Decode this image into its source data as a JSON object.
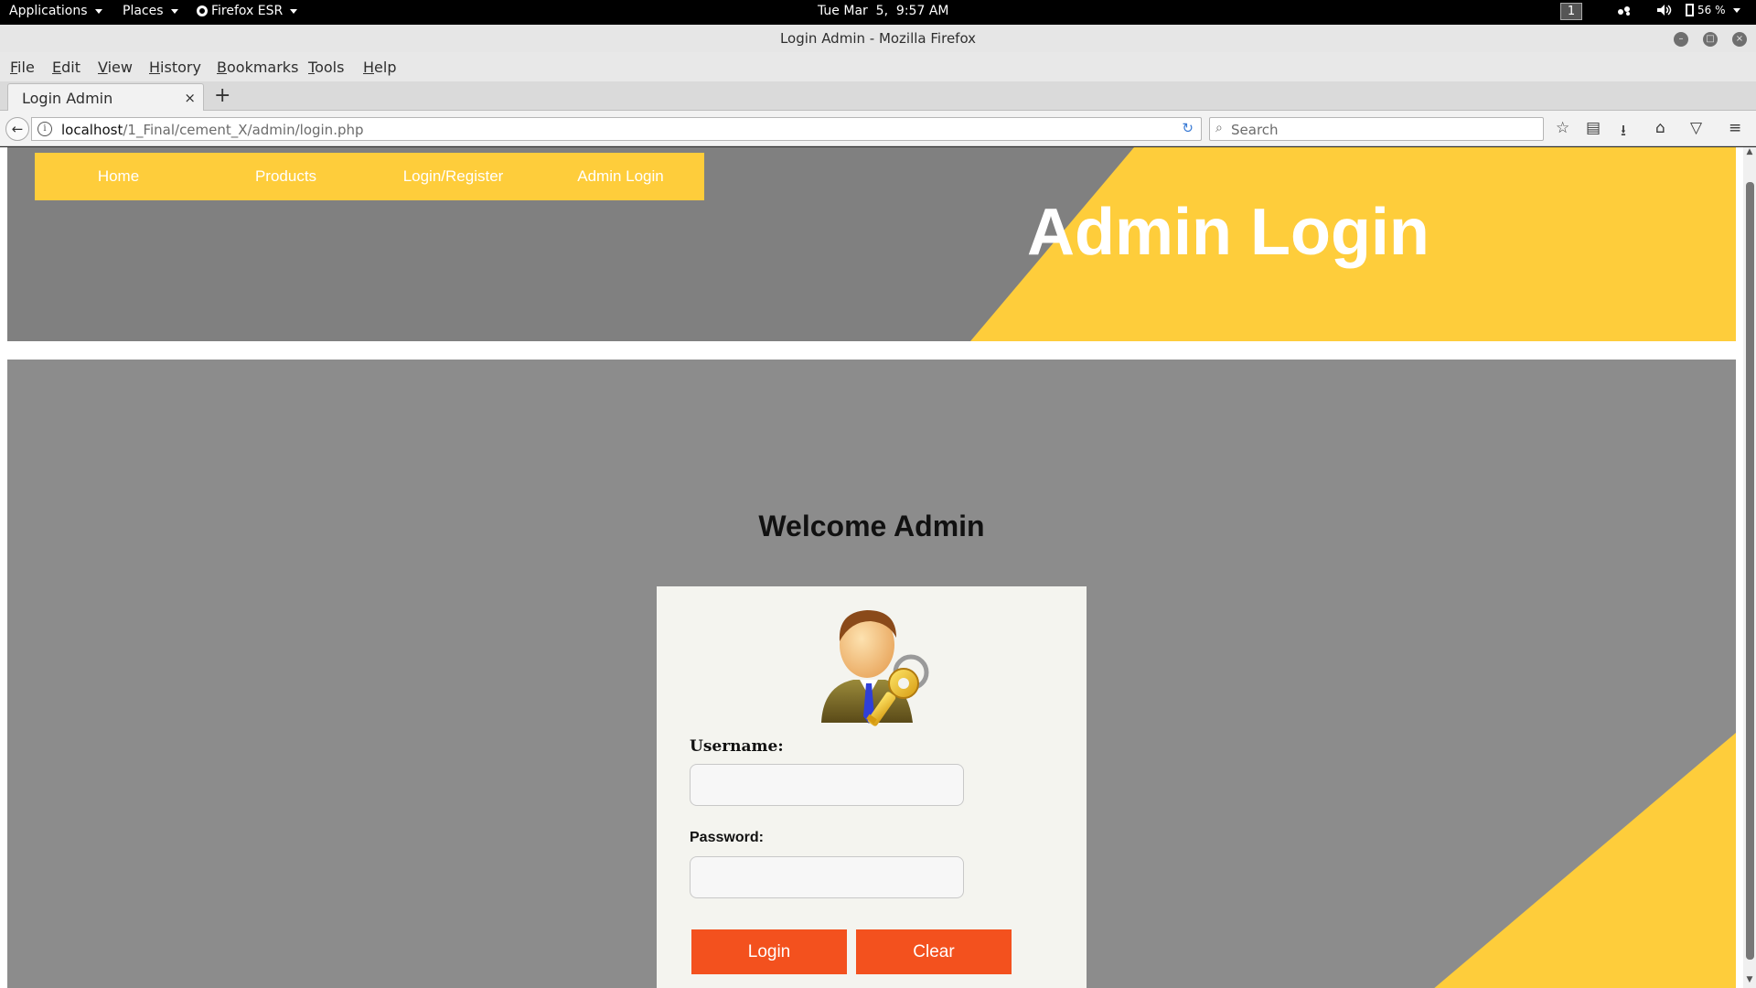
{
  "system_bar": {
    "applications": "Applications",
    "places": "Places",
    "firefox": "Firefox ESR",
    "clock": "Tue Mar  5,  9:57 AM",
    "workspace": "1",
    "battery": "56 %"
  },
  "window": {
    "title": "Login Admin - Mozilla Firefox"
  },
  "menu": [
    "File",
    "Edit",
    "View",
    "History",
    "Bookmarks",
    "Tools",
    "Help"
  ],
  "tab": {
    "label": "Login Admin",
    "close": "×",
    "new_tab": "+"
  },
  "urlbar": {
    "host": "localhost",
    "path": "/1_Final/cement_X/admin/login.php"
  },
  "searchbar": {
    "placeholder": "Search"
  },
  "site_nav": [
    "Home",
    "Products",
    "Login/Register",
    "Admin Login"
  ],
  "header": {
    "title": "Admin Login"
  },
  "main": {
    "welcome": "Welcome Admin"
  },
  "login_form": {
    "username_label": "Username:",
    "password_label": "Password:",
    "username_value": "",
    "password_value": "",
    "login_label": "Login",
    "clear_label": "Clear"
  },
  "colors": {
    "accent_yellow": "#fecd3b",
    "header_gray": "#808080",
    "main_gray": "#8c8c8c",
    "button_orange": "#f3511e",
    "card_bg": "#f4f4ef"
  },
  "icons": {
    "avatar": "admin-key-avatar-icon"
  }
}
